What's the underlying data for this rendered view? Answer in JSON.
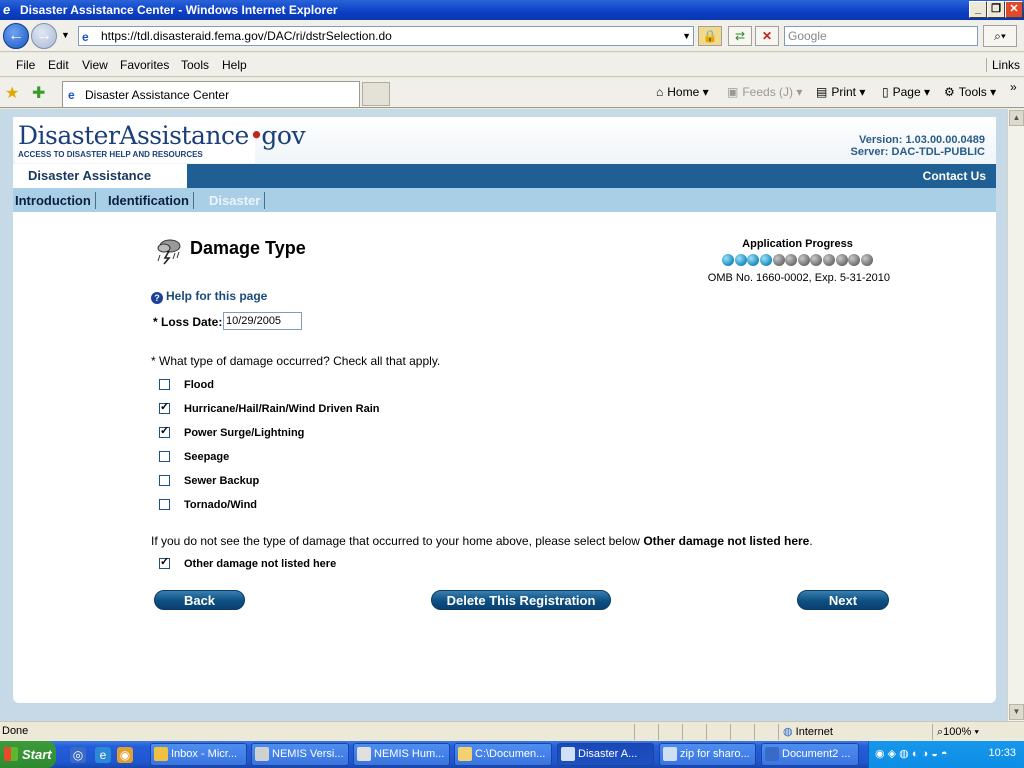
{
  "window": {
    "title": "Disaster Assistance Center - Windows Internet Explorer",
    "min": "_",
    "max": "❐",
    "close": "✕"
  },
  "address": {
    "url": "https://tdl.disasteraid.fema.gov/DAC/ri/dstrSelection.do",
    "search_placeholder": "Google"
  },
  "menu": [
    "File",
    "Edit",
    "View",
    "Favorites",
    "Tools",
    "Help"
  ],
  "menu_links": "Links",
  "tab": {
    "label": "Disaster Assistance Center"
  },
  "commands": {
    "home": "Home",
    "feeds": "Feeds (J)",
    "print": "Print",
    "page": "Page",
    "tools": "Tools"
  },
  "site": {
    "logo_main": "DisasterAssistance",
    "logo_dot": "•",
    "logo_suffix": "gov",
    "logo_tag": "ACCESS TO DISASTER HELP AND RESOURCES",
    "version": "Version: 1.03.00.00.0489",
    "server": "Server: DAC-TDL-PUBLIC",
    "section_title": "Disaster Assistance",
    "contact": "Contact Us",
    "tabs": [
      {
        "label": "Introduction"
      },
      {
        "label": "Identification"
      },
      {
        "label": "Disaster"
      }
    ]
  },
  "form": {
    "heading": "Damage Type",
    "progress_label": "Application Progress",
    "progress": {
      "completed": 4,
      "total": 12
    },
    "omb": "OMB No. 1660-0002, Exp. 5-31-2010",
    "help": "Help for this page",
    "loss_date_label": "* Loss Date:",
    "loss_date_value": "10/29/2005",
    "question": "* What type of damage occurred? Check all that apply.",
    "options": [
      {
        "label": "Flood",
        "checked": false
      },
      {
        "label": "Hurricane/Hail/Rain/Wind Driven Rain",
        "checked": true
      },
      {
        "label": "Power Surge/Lightning",
        "checked": true
      },
      {
        "label": "Seepage",
        "checked": false
      },
      {
        "label": "Sewer Backup",
        "checked": false
      },
      {
        "label": "Tornado/Wind",
        "checked": false
      }
    ],
    "not_listed_text": "If you do not see the type of damage that occurred to your home above, please select below ",
    "not_listed_bold": "Other damage not listed here",
    "not_listed_end": ".",
    "other_label": "Other damage not listed here",
    "other_checked": true,
    "back": "Back",
    "delete": "Delete This Registration",
    "next": "Next"
  },
  "status": {
    "text": "Done",
    "zone": "Internet",
    "zoom": "100%"
  },
  "taskbar": {
    "start": "Start",
    "items": [
      {
        "label": "Inbox - Micr..."
      },
      {
        "label": "NEMIS Versi..."
      },
      {
        "label": "NEMIS Hum..."
      },
      {
        "label": "C:\\Documen..."
      },
      {
        "label": "Disaster A..."
      },
      {
        "label": "zip for sharo..."
      },
      {
        "label": "Document2 ..."
      }
    ],
    "clock": "10:33"
  },
  "colors": {
    "accent": "#1f5f94",
    "button": "#0d4f82",
    "progress_done": "#1a8bc0",
    "progress_todo": "#6d6d6d"
  }
}
